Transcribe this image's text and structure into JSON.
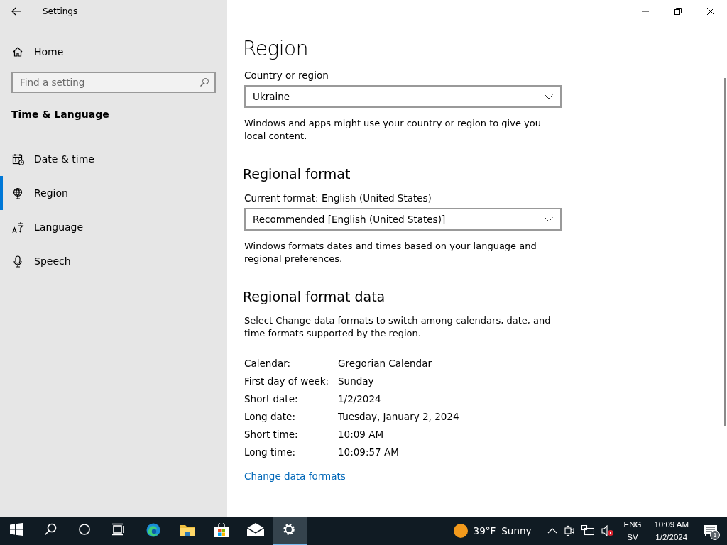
{
  "window": {
    "title": "Settings"
  },
  "sidebar": {
    "home": "Home",
    "search": {
      "placeholder": "Find a setting"
    },
    "category": "Time & Language",
    "items": [
      {
        "label": "Date & time",
        "kind": "calendar",
        "selected": false
      },
      {
        "label": "Region",
        "kind": "globe",
        "selected": true
      },
      {
        "label": "Language",
        "kind": "language",
        "selected": false
      },
      {
        "label": "Speech",
        "kind": "microphone",
        "selected": false
      }
    ]
  },
  "page": {
    "title": "Region",
    "country": {
      "label": "Country or region",
      "value": "Ukraine",
      "note": "Windows and apps might use your country or region to give you local content."
    },
    "format": {
      "heading": "Regional format",
      "label": "Current format: English (United States)",
      "value": "Recommended [English (United States)]",
      "note": "Windows formats dates and times based on your language and regional preferences."
    },
    "format_data": {
      "heading": "Regional format data",
      "note": "Select Change data formats to switch among calendars, date, and time formats supported by the region.",
      "rows": [
        {
          "label": "Calendar:",
          "value": "Gregorian Calendar"
        },
        {
          "label": "First day of week:",
          "value": "Sunday"
        },
        {
          "label": "Short date:",
          "value": "1/2/2024"
        },
        {
          "label": "Long date:",
          "value": "Tuesday, January 2, 2024"
        },
        {
          "label": "Short time:",
          "value": "10:09 AM"
        },
        {
          "label": "Long time:",
          "value": "10:09:57 AM"
        }
      ],
      "link": "Change data formats"
    }
  },
  "taskbar": {
    "apps": [
      {
        "kind": "start",
        "selected": false
      },
      {
        "kind": "search",
        "selected": false
      },
      {
        "kind": "cortana",
        "selected": false
      },
      {
        "kind": "taskview",
        "selected": false
      },
      {
        "kind": "edge",
        "selected": false
      },
      {
        "kind": "explorer",
        "selected": false
      },
      {
        "kind": "store",
        "selected": false
      },
      {
        "kind": "mail",
        "selected": false
      },
      {
        "kind": "settings",
        "selected": true
      }
    ],
    "weather": {
      "temperature": "39°F",
      "condition": "Sunny"
    },
    "language": {
      "code": "ENG",
      "layout": "SV"
    },
    "clock": {
      "time": "10:09 AM",
      "date": "1/2/2024"
    },
    "notifications": "1"
  }
}
